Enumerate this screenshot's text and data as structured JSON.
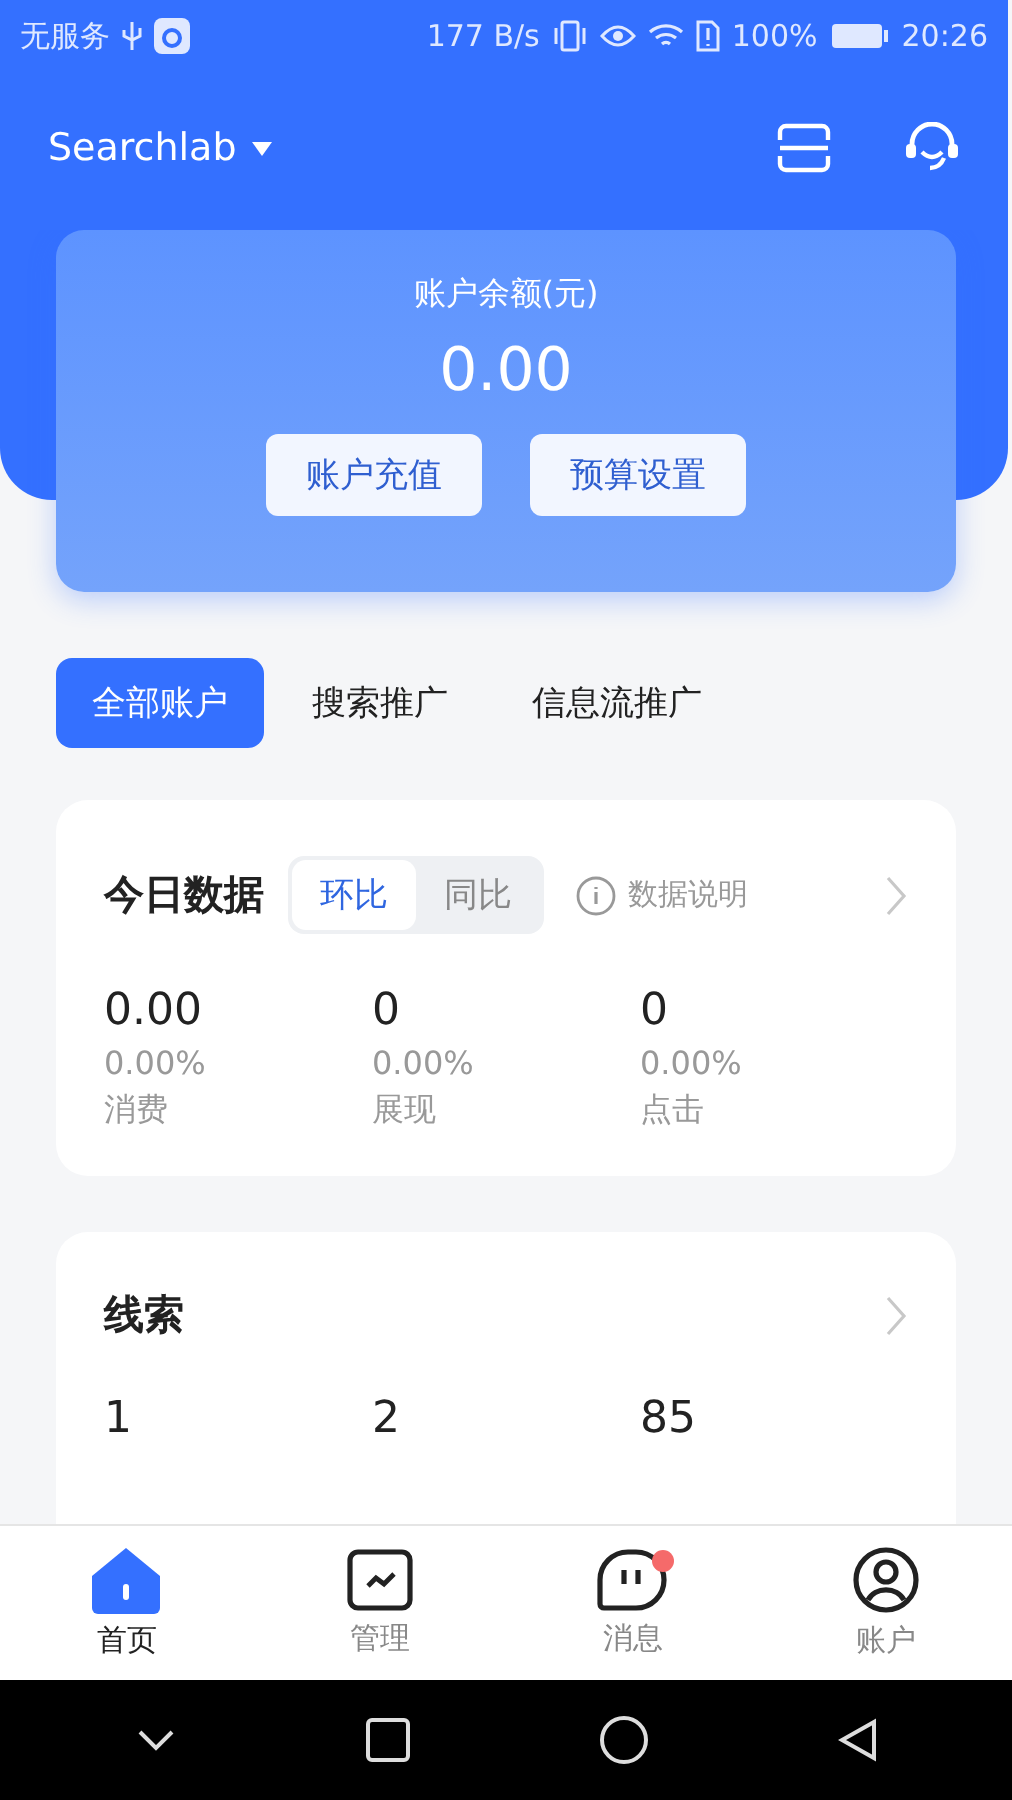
{
  "status_bar": {
    "carrier": "无服务",
    "speed": "177 B/s",
    "battery": "100%",
    "time": "20:26"
  },
  "header": {
    "account": "Searchlab"
  },
  "balance": {
    "label": "账户余额(元)",
    "amount": "0.00",
    "buttons": [
      "账户充值",
      "预算设置"
    ]
  },
  "account_tabs": [
    {
      "label": "全部账户",
      "selected": true
    },
    {
      "label": "搜索推广",
      "selected": false
    },
    {
      "label": "信息流推广",
      "selected": false
    }
  ],
  "today": {
    "title": "今日数据",
    "toggle": [
      {
        "label": "环比",
        "selected": true
      },
      {
        "label": "同比",
        "selected": false
      }
    ],
    "info": "数据说明",
    "metrics": [
      {
        "value": "0.00",
        "change": "0.00%",
        "label": "消费"
      },
      {
        "value": "0",
        "change": "0.00%",
        "label": "展现"
      },
      {
        "value": "0",
        "change": "0.00%",
        "label": "点击"
      }
    ]
  },
  "leads": {
    "title": "线索",
    "values": [
      "1",
      "2",
      "85"
    ]
  },
  "bottom_nav": [
    {
      "label": "首页",
      "selected": true,
      "badge": false
    },
    {
      "label": "管理",
      "selected": false,
      "badge": false
    },
    {
      "label": "消息",
      "selected": false,
      "badge": true
    },
    {
      "label": "账户",
      "selected": false,
      "badge": false
    }
  ]
}
